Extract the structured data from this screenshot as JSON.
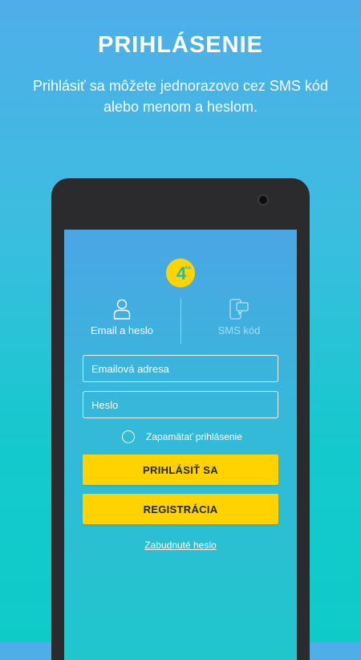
{
  "promo": {
    "title": "PRIHLÁSENIE",
    "subtitle": "Prihlásiť sa môžete jednorazovo cez SMS kód alebo menom a heslom."
  },
  "logo": {
    "text": "4",
    "superscript": "ka",
    "color": "#ffd400"
  },
  "tabs": {
    "email_label": "Email a heslo",
    "sms_label": "SMS kód",
    "email_icon": "user-icon",
    "sms_icon": "phone-message-icon"
  },
  "form": {
    "email_placeholder": "Emailová adresa",
    "email_value": "",
    "password_placeholder": "Heslo",
    "password_value": "",
    "remember_label": "Zapamätať prihlásenie",
    "remember_checked": false
  },
  "buttons": {
    "login_label": "PRIHLÁSIŤ SA",
    "register_label": "REGISTRÁCIA",
    "color": "#ffd200"
  },
  "links": {
    "forgot_password": "Zabudnuté heslo"
  }
}
